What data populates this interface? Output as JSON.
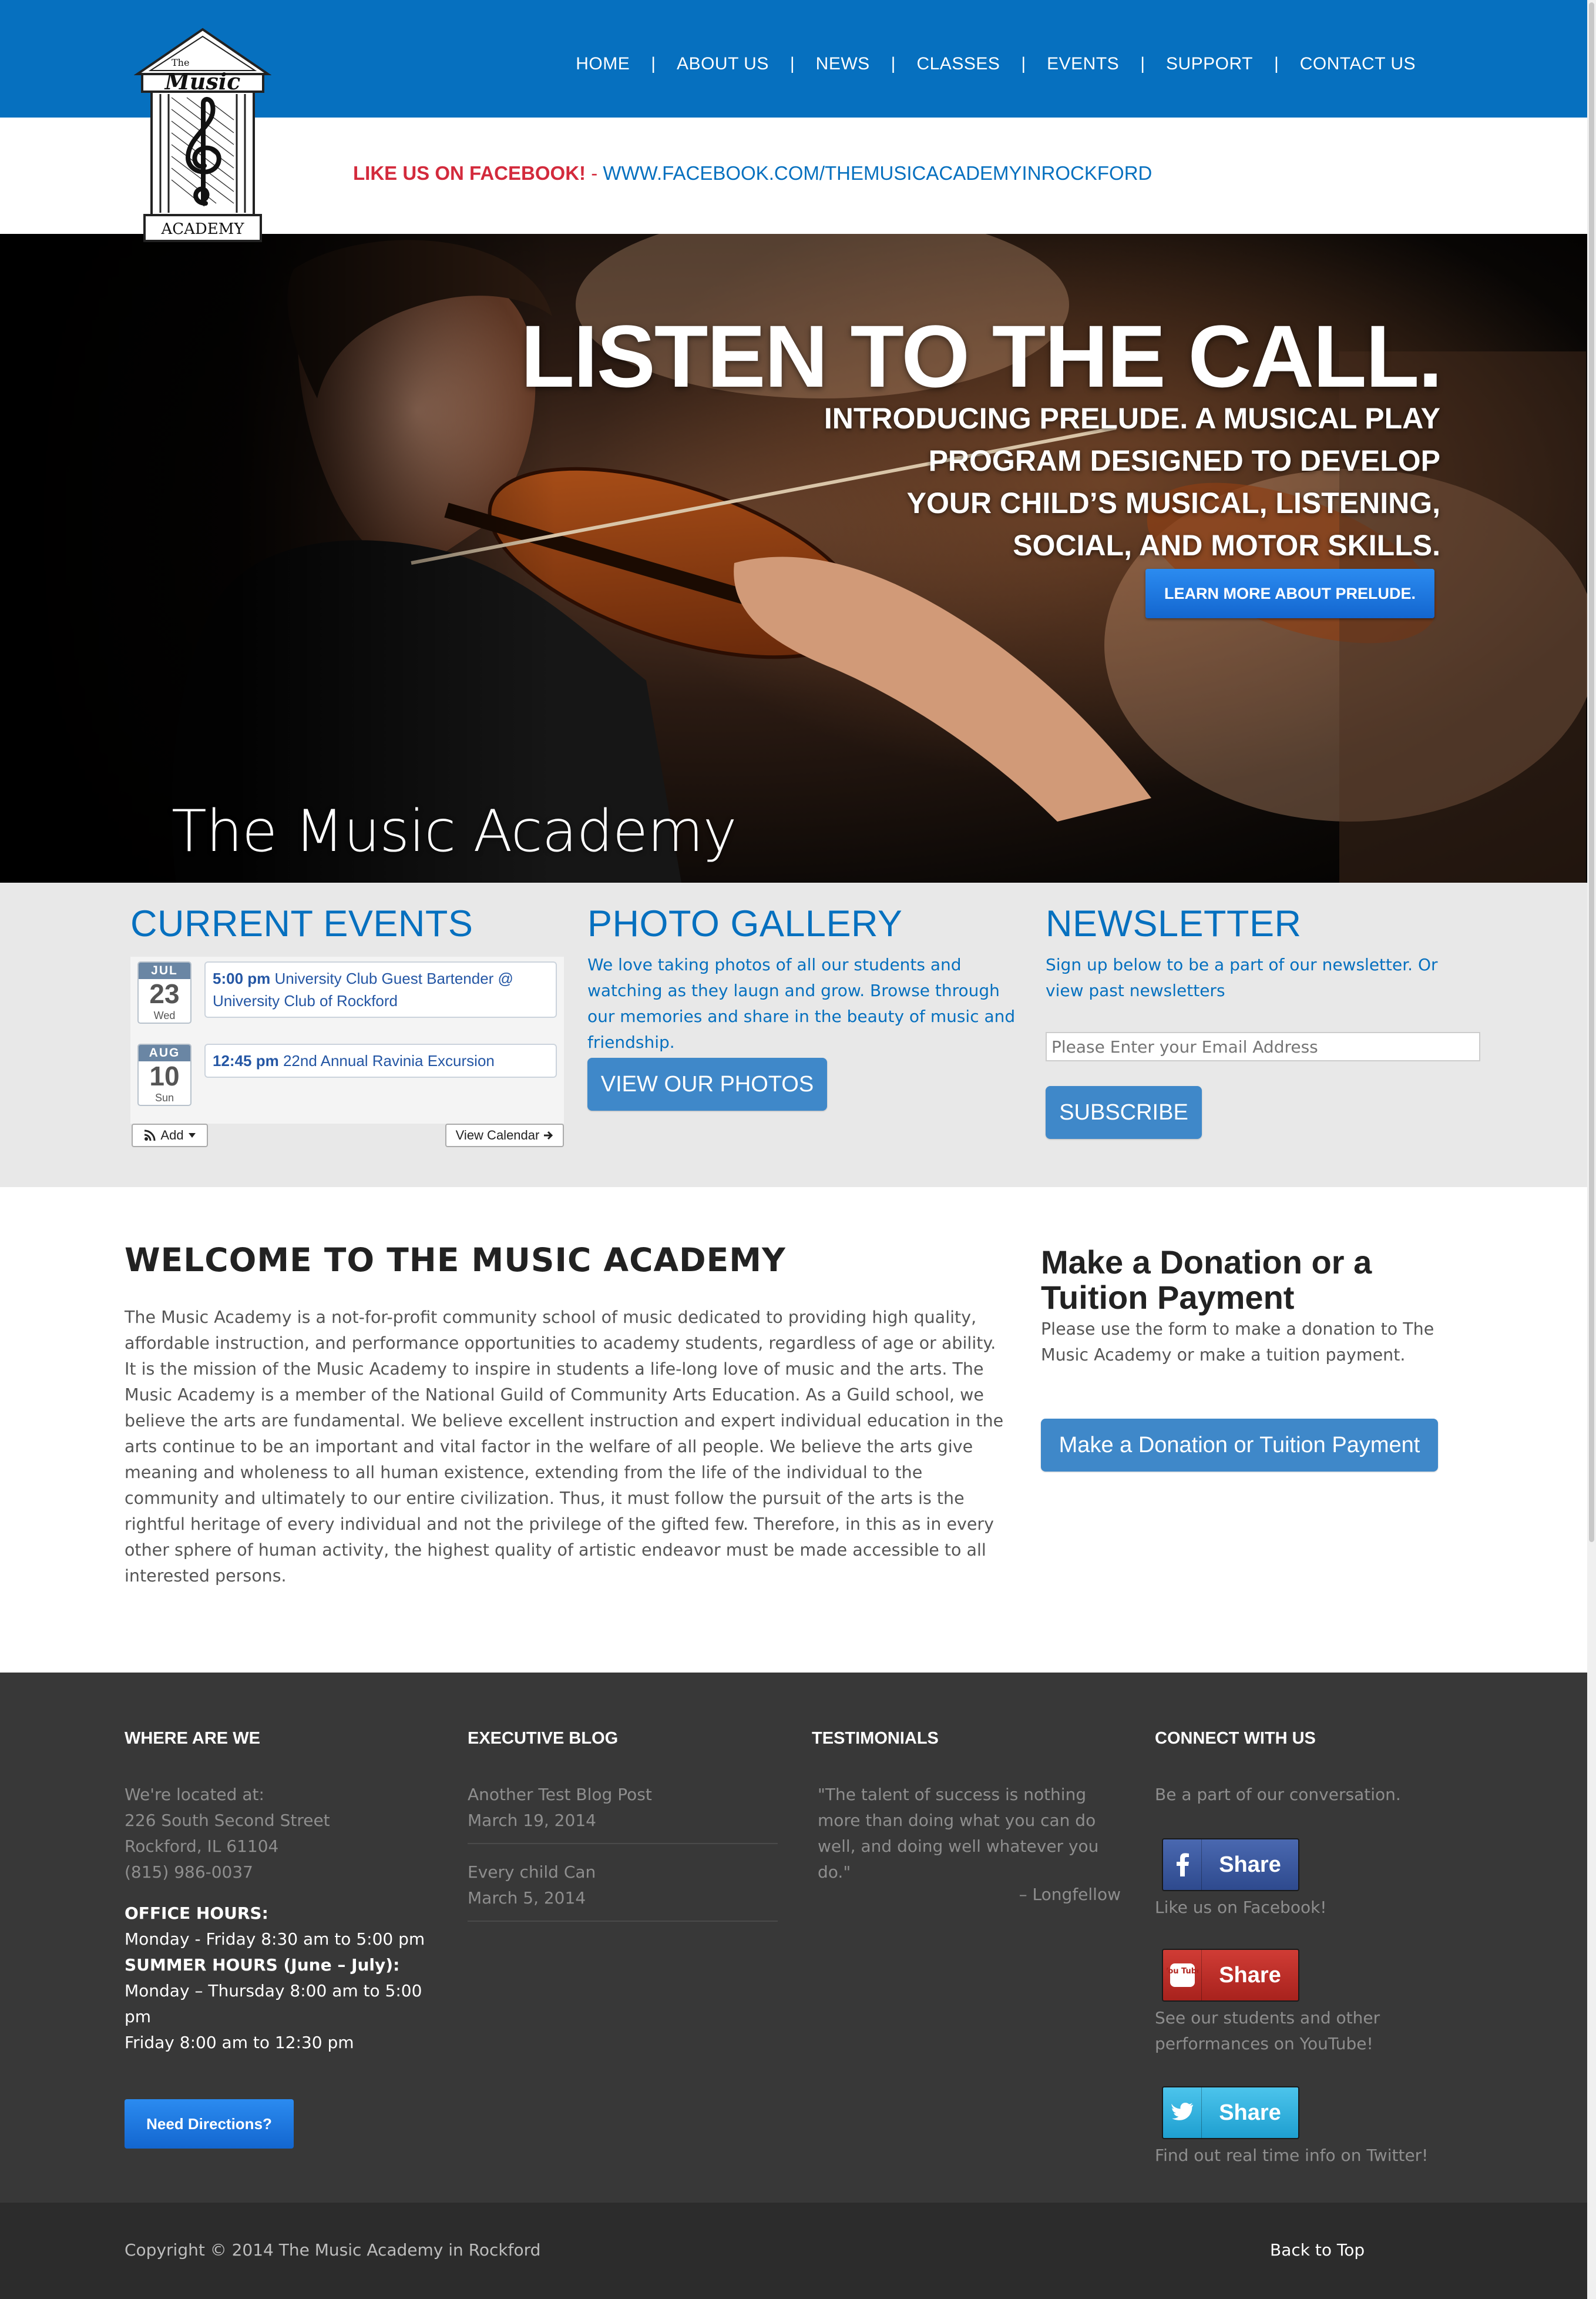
{
  "header": {
    "nav": [
      "HOME",
      "ABOUT US",
      "NEWS",
      "CLASSES",
      "EVENTS",
      "SUPPORT",
      "CONTACT US"
    ],
    "separator": "|",
    "logo": {
      "top_text": "The",
      "name": "Music",
      "bottom_text": "ACADEMY"
    },
    "facebook_label": "LIKE US ON FACEBOOK!",
    "facebook_dash": " - ",
    "facebook_url": "WWW.FACEBOOK.COM/THEMUSICACADEMYINROCKFORD"
  },
  "hero": {
    "title": "LISTEN TO THE CALL.",
    "subtitle_lines": [
      "INTRODUCING PRELUDE. A MUSICAL PLAY",
      "PROGRAM DESIGNED TO DEVELOP",
      "YOUR CHILD’S MUSICAL, LISTENING,",
      "SOCIAL, AND MOTOR SKILLS."
    ],
    "button": "LEARN MORE ABOUT PRELUDE.",
    "caption": "The Music Academy"
  },
  "widgets": {
    "events": {
      "title": "CURRENT EVENTS",
      "items": [
        {
          "month": "JUL",
          "day": "23",
          "weekday": "Wed",
          "time": "5:00 pm",
          "name": "University Club Guest Bartender @ University Club of Rockford"
        },
        {
          "month": "AUG",
          "day": "10",
          "weekday": "Sun",
          "time": "12:45 pm",
          "name": "22nd Annual Ravinia Excursion"
        }
      ],
      "add_label": "Add",
      "view_label": "View Calendar"
    },
    "gallery": {
      "title": "PHOTO GALLERY",
      "text": "We love taking photos of all our students and watching as they laugn and grow. Browse through our memories and share in the beauty of music and friendship.",
      "button": "VIEW OUR PHOTOS"
    },
    "newsletter": {
      "title": "NEWSLETTER",
      "text": "Sign up below to be a part of our newsletter. Or view past newsletters",
      "placeholder": "Please Enter your Email Address",
      "button": "SUBSCRIBE"
    }
  },
  "main": {
    "welcome_title": "WELCOME TO THE MUSIC ACADEMY",
    "welcome_body": "The Music Academy is a not-for-profit community school of music dedicated to providing high quality, affordable instruction, and performance opportunities to academy students, regardless of age or ability. It is the mission of the Music Academy to inspire in students a life-long love of music and the arts. The Music Academy is a member of the National Guild of Community Arts Education. As a Guild school, we believe the arts are fundamental. We believe excellent instruction and expert individual education in the arts continue to be an important and vital factor in the welfare of all people. We believe the arts give meaning and wholeness to all human existence, extending from the life of the individual to the community and ultimately to our entire civilization. Thus, it must follow the pursuit of the arts is the rightful heritage of every individual and not the privilege of the gifted few. Therefore, in this as in every other sphere of human activity, the highest quality of artistic endeavor must be made accessible to all interested persons.",
    "donation_title": "Make a Donation or a Tuition Payment",
    "donation_text": "Please use the form to make a donation to The Music Academy or make a tuition payment.",
    "donation_button": "Make a Donation or Tuition Payment"
  },
  "footer": {
    "where": {
      "title": "WHERE ARE WE",
      "located": "We're located at:",
      "street": "226 South Second Street",
      "city": "Rockford, IL 61104",
      "phone": "(815) 986-0037",
      "hours_title": "OFFICE HOURS:",
      "hours": "Monday - Friday 8:30 am to 5:00 pm",
      "summer_title": "SUMMER HOURS (June – July):",
      "summer_1": "Monday – Thursday 8:00 am to 5:00 pm",
      "summer_2": "Friday 8:00 am to 12:30 pm",
      "button": "Need Directions?"
    },
    "blog": {
      "title": "EXECUTIVE BLOG",
      "posts": [
        {
          "title": "Another Test Blog Post",
          "date": "March 19, 2014"
        },
        {
          "title": "Every child Can",
          "date": "March 5, 2014"
        }
      ]
    },
    "testimonials": {
      "title": "TESTIMONIALS",
      "quote": "\"The talent of success is nothing more than doing what you can do well, and doing well whatever you do.\"",
      "author": "– Longfellow"
    },
    "connect": {
      "title": "CONNECT WITH US",
      "intro": "Be a part of our conversation.",
      "share_label": "Share",
      "facebook_text": "Like us on Facebook!",
      "youtube_text": "See our students and other performances on YouTube!",
      "twitter_text": "Find out real time info on Twitter!",
      "youtube_icon_text": "You Tube"
    },
    "copyright": "Copyright © 2014 The Music Academy in Rockford",
    "back_to_top": "Back to Top"
  },
  "colors": {
    "brand_blue": "#0670bf",
    "accent_red": "#d32a3c",
    "footer_bg": "#383838",
    "widget_bg": "#e8e8e8"
  },
  "icons": [
    "rss-icon",
    "caret-down-icon",
    "arrow-right-icon",
    "facebook-icon",
    "youtube-icon",
    "twitter-bird-icon",
    "treble-clef-icon"
  ]
}
